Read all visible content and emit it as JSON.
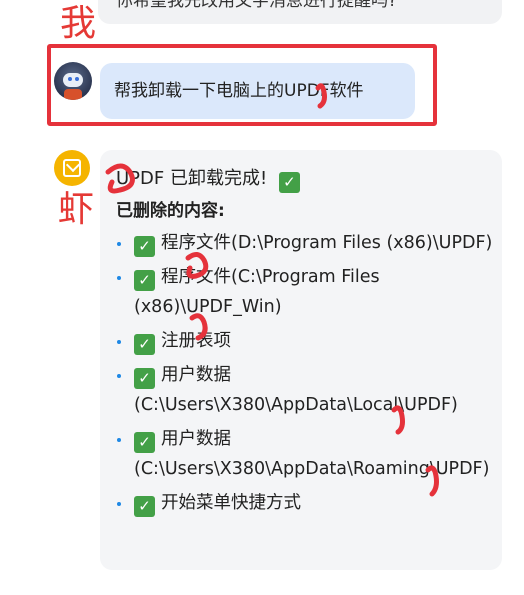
{
  "previous_message": "你希望我先改用文字消息进行提醒吗?",
  "annotations": {
    "me": "我",
    "shrimp": "虾"
  },
  "user_message": "帮我卸载一下电脑上的UPDF软件",
  "bot_reply": {
    "title": "UPDF 已卸载完成!",
    "subtitle": "已删除的内容:",
    "items": [
      {
        "text": "程序文件(D:\\Program Files (x86)\\UPDF)"
      },
      {
        "text": "程序文件(C:\\Program Files (x86)\\UPDF_Win)"
      },
      {
        "text": "注册表项"
      },
      {
        "text": "用户数据(C:\\Users\\X380\\AppData\\Local\\UPDF)"
      },
      {
        "text": "用户数据(C:\\Users\\X380\\AppData\\Roaming\\UPDF)"
      },
      {
        "text": "开始菜单快捷方式"
      }
    ]
  },
  "icons": {
    "check": "✓",
    "user_avatar": "robot-avatar",
    "bot_avatar": "cube-avatar"
  },
  "colors": {
    "user_bubble": "#dbe8fb",
    "bot_bubble": "#f4f5f7",
    "annotation": "#e5323b",
    "check": "#43a047",
    "bullet": "#1e88e5"
  }
}
